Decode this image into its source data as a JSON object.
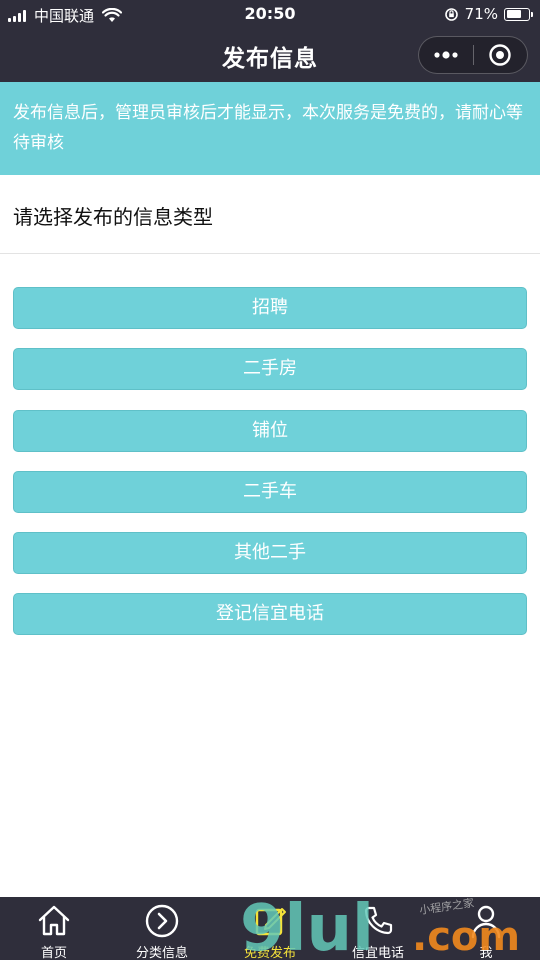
{
  "status_bar": {
    "carrier": "中国联通",
    "time": "20:50",
    "battery": "71%",
    "battery_level": 0.71
  },
  "nav": {
    "title": "发布信息"
  },
  "notice": {
    "text": "发布信息后，管理员审核后才能显示，本次服务是免费的，请耐心等待审核"
  },
  "section": {
    "title": "请选择发布的信息类型"
  },
  "types": [
    {
      "label": "招聘"
    },
    {
      "label": "二手房"
    },
    {
      "label": "铺位"
    },
    {
      "label": "二手车"
    },
    {
      "label": "其他二手"
    },
    {
      "label": "登记信宜电话"
    }
  ],
  "tabs": [
    {
      "label": "首页",
      "icon": "home-icon"
    },
    {
      "label": "分类信息",
      "icon": "chevron-circle-icon"
    },
    {
      "label": "免费发布",
      "icon": "edit-icon",
      "active": true
    },
    {
      "label": "信宜电话",
      "icon": "phone-icon"
    },
    {
      "label": "我",
      "icon": "user-icon"
    }
  ],
  "watermark": {
    "brand": "9lul",
    "suffix": ".com",
    "tagline": "小程序之家"
  },
  "colors": {
    "header_bg": "#2f2e3b",
    "accent": "#6fd1d9",
    "active_tab": "#f5e23a"
  }
}
